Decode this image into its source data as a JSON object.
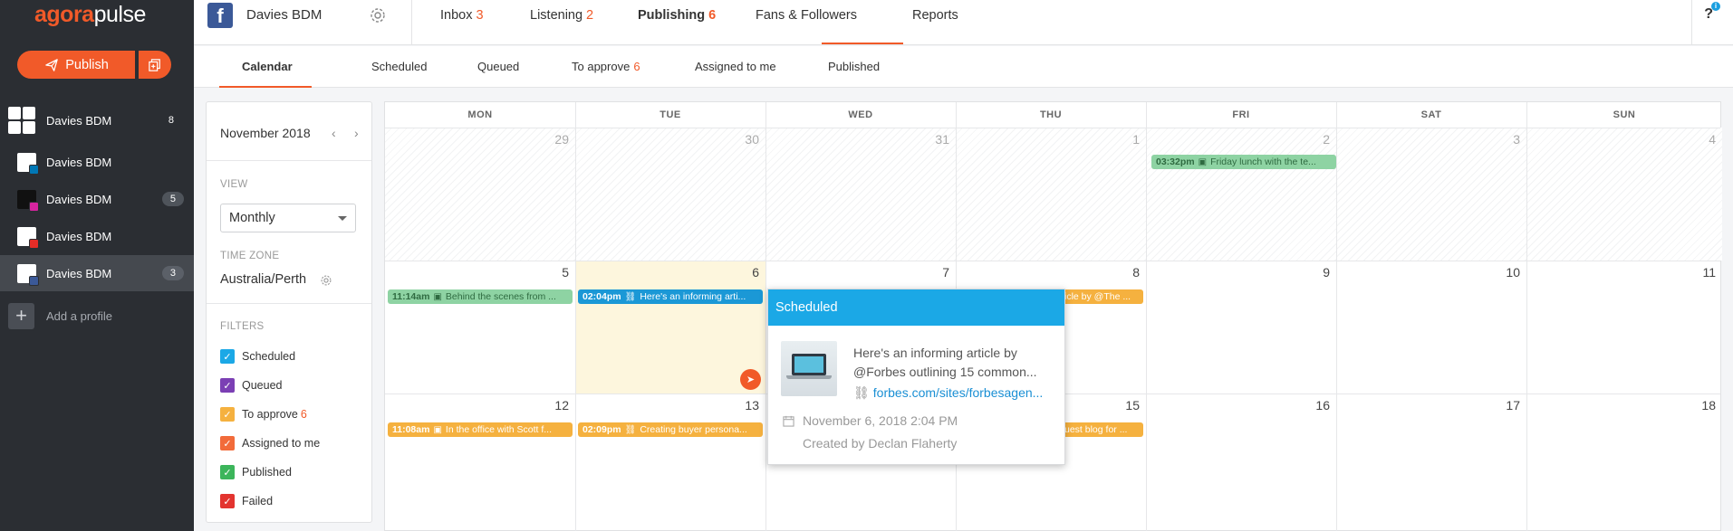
{
  "brand": {
    "logo_part1": "agora",
    "logo_part2": "pulse",
    "accent": "#f15a29"
  },
  "sidebar": {
    "publish_label": "Publish",
    "profiles": [
      {
        "name": "Davies BDM",
        "count": "8",
        "network": "all"
      },
      {
        "name": "Davies BDM",
        "count": "",
        "network": "linkedin"
      },
      {
        "name": "Davies BDM",
        "count": "5",
        "network": "instagram"
      },
      {
        "name": "Davies BDM",
        "count": "",
        "network": "youtube"
      },
      {
        "name": "Davies BDM",
        "count": "3",
        "network": "facebook"
      }
    ],
    "add_profile": "Add a profile"
  },
  "topbar": {
    "account": "Davies BDM",
    "nav": [
      {
        "label": "Inbox",
        "count": "3"
      },
      {
        "label": "Listening",
        "count": "2"
      },
      {
        "label": "Publishing",
        "count": "6"
      },
      {
        "label": "Fans & Followers",
        "count": ""
      },
      {
        "label": "Reports",
        "count": ""
      }
    ],
    "help": "?"
  },
  "subnav": [
    {
      "label": "Calendar",
      "count": ""
    },
    {
      "label": "Scheduled",
      "count": ""
    },
    {
      "label": "Queued",
      "count": ""
    },
    {
      "label": "To approve",
      "count": "6"
    },
    {
      "label": "Assigned to me",
      "count": ""
    },
    {
      "label": "Published",
      "count": ""
    }
  ],
  "panel": {
    "month": "November 2018",
    "view_title": "VIEW",
    "view_value": "Monthly",
    "tz_title": "TIME ZONE",
    "tz_value": "Australia/Perth",
    "filters_title": "FILTERS",
    "filters": [
      {
        "label": "Scheduled",
        "count": "",
        "color": "#1ba8e6"
      },
      {
        "label": "Queued",
        "count": "",
        "color": "#7b3fb4"
      },
      {
        "label": "To approve",
        "count": "6",
        "color": "#f5b13f"
      },
      {
        "label": "Assigned to me",
        "count": "",
        "color": "#f26b3a"
      },
      {
        "label": "Published",
        "count": "",
        "color": "#3cb55b"
      },
      {
        "label": "Failed",
        "count": "",
        "color": "#e3342f"
      }
    ]
  },
  "calendar": {
    "days": [
      "MON",
      "TUE",
      "WED",
      "THU",
      "FRI",
      "SAT",
      "SUN"
    ],
    "weeks": [
      [
        "29",
        "30",
        "31",
        "1",
        "2",
        "3",
        "4"
      ],
      [
        "5",
        "6",
        "7",
        "8",
        "9",
        "10",
        "11"
      ],
      [
        "12",
        "13",
        "14",
        "15",
        "16",
        "17",
        "18"
      ]
    ],
    "posts": [
      {
        "time": "03:32pm",
        "text": "Friday lunch with the te...",
        "kind": "image"
      },
      {
        "time": "11:14am",
        "text": "Behind the scenes from ...",
        "kind": "image"
      },
      {
        "time": "02:04pm",
        "text": "Here's an informing arti...",
        "kind": "link"
      },
      {
        "time": "",
        "text": "icle by @The ...",
        "kind": ""
      },
      {
        "time": "11:08am",
        "text": "In the office with Scott f...",
        "kind": "image"
      },
      {
        "time": "02:09pm",
        "text": "Creating buyer persona...",
        "kind": "link"
      },
      {
        "time": "",
        "text": "uest blog for ...",
        "kind": ""
      }
    ]
  },
  "popover": {
    "title": "Scheduled",
    "text": "Here's an informing article by @Forbes outlining 15 common...",
    "link": "forbes.com/sites/forbesagen...",
    "date": "November 6, 2018 2:04 PM",
    "creator": "Created by Declan Flaherty"
  }
}
